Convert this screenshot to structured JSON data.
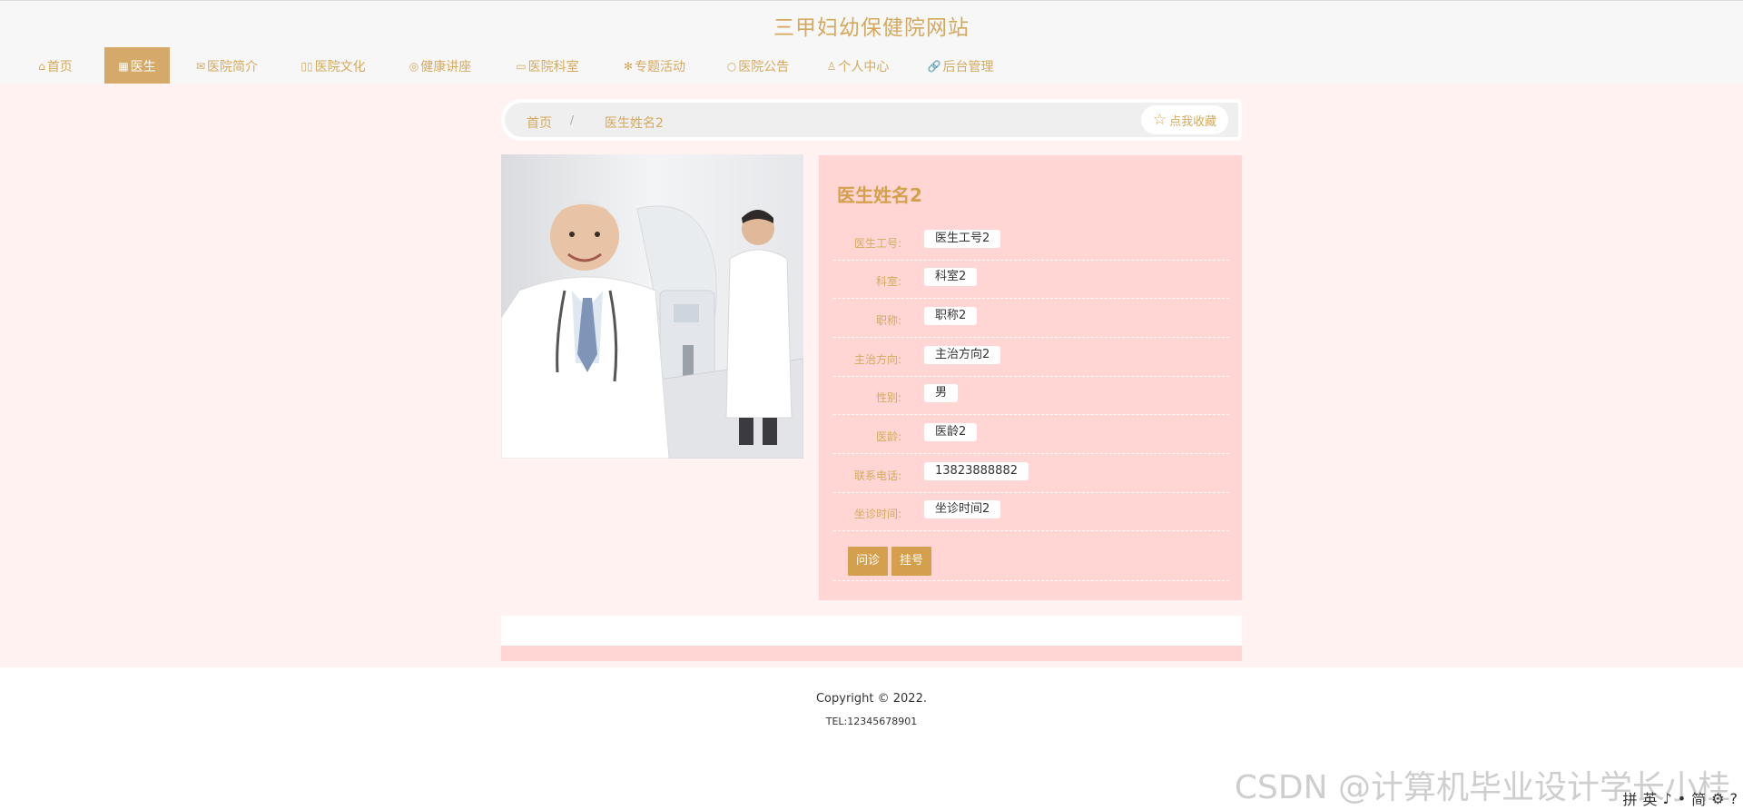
{
  "site": {
    "title": "三甲妇幼保健院网站"
  },
  "nav": [
    {
      "icon": "home-icon",
      "glyph": "⌂",
      "label": "首页",
      "active": false
    },
    {
      "icon": "doctor-icon",
      "glyph": "▦",
      "label": "医生",
      "active": true
    },
    {
      "icon": "mail-icon",
      "glyph": "✉",
      "label": "医院简介",
      "active": false
    },
    {
      "icon": "book-icon",
      "glyph": "▯▯",
      "label": "医院文化",
      "active": false
    },
    {
      "icon": "globe-icon",
      "glyph": "◎",
      "label": "健康讲座",
      "active": false
    },
    {
      "icon": "document-icon",
      "glyph": "▭",
      "label": "医院科室",
      "active": false
    },
    {
      "icon": "snowflake-icon",
      "glyph": "✻",
      "label": "专题活动",
      "active": false
    },
    {
      "icon": "circle-icon",
      "glyph": "○",
      "label": "医院公告",
      "active": false
    },
    {
      "icon": "user-icon",
      "glyph": "♙",
      "label": "个人中心",
      "active": false
    },
    {
      "icon": "link-icon",
      "glyph": "🔗",
      "label": "后台管理",
      "active": false
    }
  ],
  "breadcrumb": {
    "home": "首页",
    "separator": "/",
    "current": "医生姓名2"
  },
  "favorite": {
    "label": "点我收藏",
    "icon": "star-icon",
    "glyph": "☆"
  },
  "doctor": {
    "name": "医生姓名2",
    "fields": [
      {
        "label": "医生工号:",
        "value": "医生工号2"
      },
      {
        "label": "科室:",
        "value": "科室2"
      },
      {
        "label": "职称:",
        "value": "职称2"
      },
      {
        "label": "主治方向:",
        "value": "主治方向2"
      },
      {
        "label": "性别:",
        "value": "男"
      },
      {
        "label": "医龄:",
        "value": "医龄2"
      },
      {
        "label": "联系电话:",
        "value": "13823888882"
      },
      {
        "label": "坐诊时间:",
        "value": "坐诊时间2"
      }
    ],
    "buttons": {
      "consult": "问诊",
      "register": "挂号"
    }
  },
  "footer": {
    "copyright": "Copyright © 2022.",
    "tel": "TEL:12345678901"
  },
  "watermark": "CSDN @计算机毕业设计学长小桂",
  "ime": {
    "items": [
      "拼",
      "英",
      "♪",
      "•",
      "简",
      "⚙",
      "?"
    ]
  },
  "colors": {
    "accent": "#d4a95e",
    "active_nav": "#d4a96a",
    "panel": "#ffd6d3",
    "page_bg": "#fff2f0",
    "button": "#d4a04e"
  }
}
